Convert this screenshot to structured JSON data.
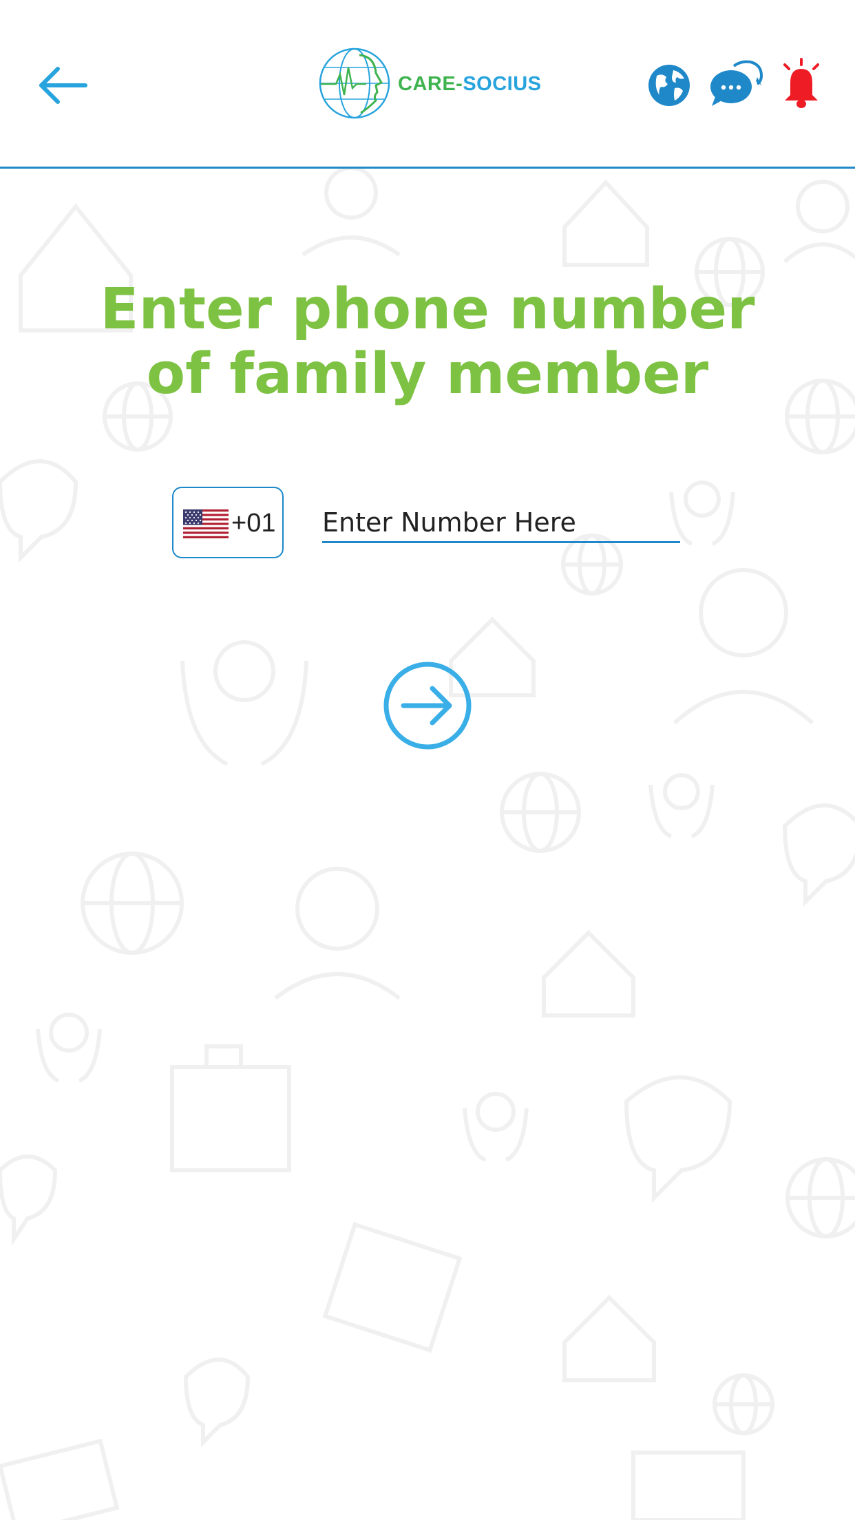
{
  "header": {
    "back_icon": "arrow-left-icon",
    "logo_icon": "globe-face-heartbeat-icon",
    "brand_part1": "CARE-",
    "brand_part2": "SOCIUS",
    "icons": [
      "globe-icon",
      "chat-bubbles-icon",
      "alarm-bell-icon"
    ],
    "colors": {
      "primary_blue": "#1e88c9",
      "light_blue": "#27a3dd",
      "brand_green": "#3fb34f",
      "alert_red": "#ee1c25"
    }
  },
  "main": {
    "title": "Enter phone number of family member",
    "title_color": "#7dc242",
    "country_code": "+01",
    "country_flag_icon": "us-flag-icon",
    "phone_placeholder": "Enter Number Here",
    "phone_value": "",
    "submit_icon": "arrow-right-circle-icon"
  }
}
